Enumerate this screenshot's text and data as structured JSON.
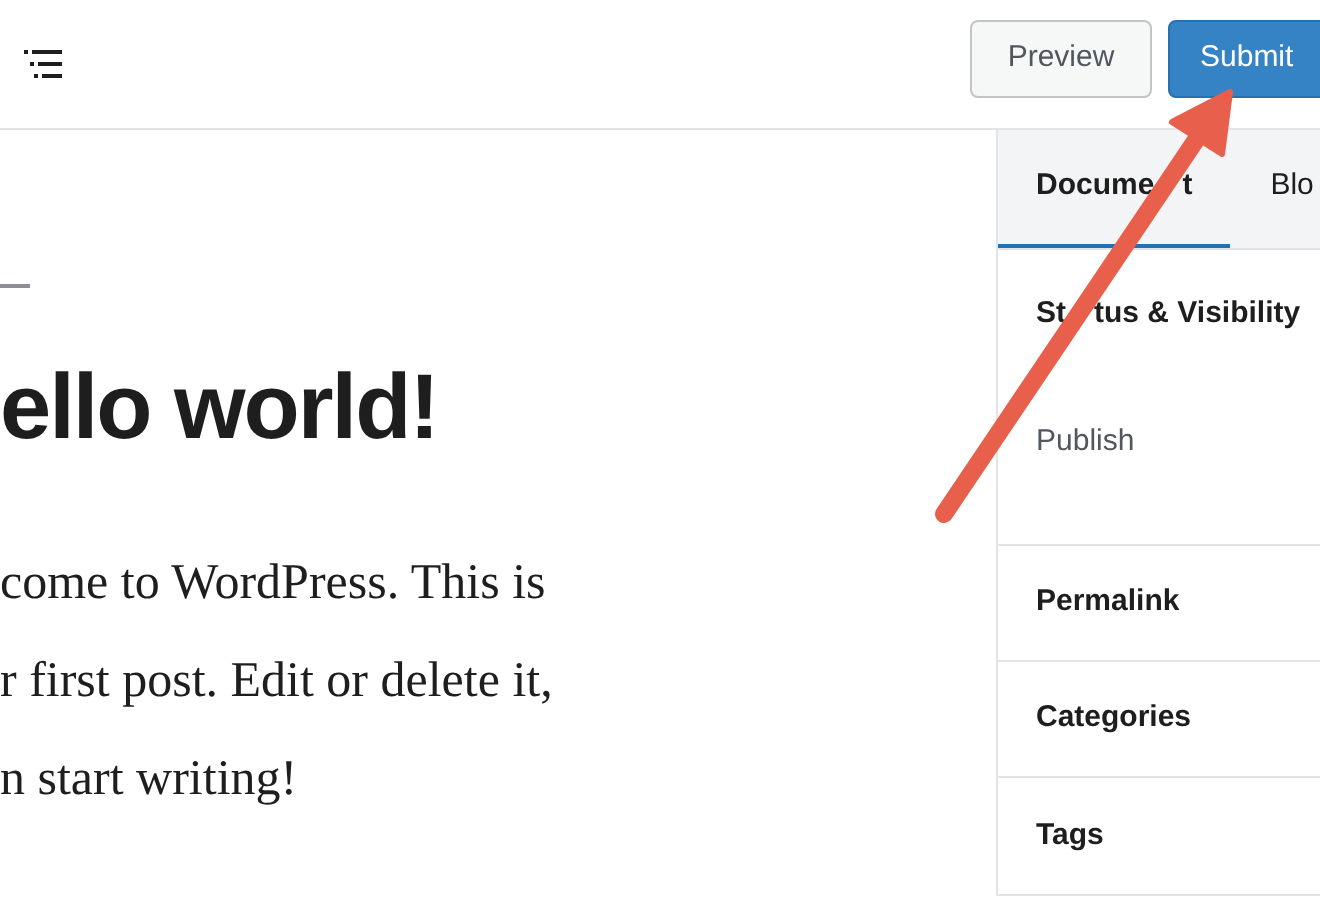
{
  "header": {
    "buttons": [
      {
        "label": "Preview",
        "kind": "secondary"
      },
      {
        "label": "Submit",
        "kind": "primary"
      }
    ]
  },
  "editor": {
    "title": "ello world!",
    "paragraph_lines": [
      "come to WordPress. This is",
      "r first post. Edit or delete it,",
      "n start writing!"
    ]
  },
  "sidebar": {
    "tabs": [
      {
        "label_parts": [
          "Docume",
          "t"
        ],
        "selected": true
      },
      {
        "label_parts": [
          "Blo"
        ],
        "selected": false
      }
    ],
    "panels": [
      {
        "title_parts": [
          "St",
          "tus & Visibility"
        ],
        "value": "Publish"
      },
      {
        "title_parts": [
          "Permalink"
        ]
      },
      {
        "title_parts": [
          "Categories"
        ]
      },
      {
        "title_parts": [
          "Tags"
        ]
      }
    ]
  }
}
